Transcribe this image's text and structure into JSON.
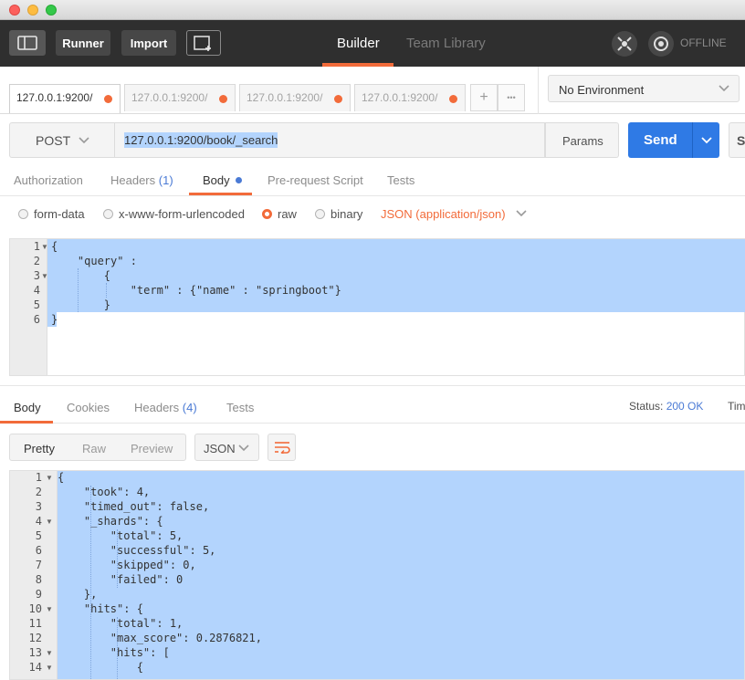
{
  "toolbar": {
    "runner_label": "Runner",
    "import_label": "Import",
    "modes": [
      "Builder",
      "Team Library"
    ],
    "offline_label": "OFFLINE"
  },
  "tabs": {
    "items": [
      {
        "label": "127.0.0.1:9200/"
      },
      {
        "label": "127.0.0.1:9200/"
      },
      {
        "label": "127.0.0.1:9200/"
      },
      {
        "label": "127.0.0.1:9200/"
      }
    ],
    "add_label": "+",
    "more_label": "•••"
  },
  "environment": {
    "selected": "No Environment"
  },
  "request": {
    "method": "POST",
    "url": "127.0.0.1:9200/book/_search",
    "params_label": "Params",
    "send_label": "Send",
    "save_label": "Sa"
  },
  "request_tabs": {
    "authorization": "Authorization",
    "headers": "Headers",
    "headers_count": "(1)",
    "body": "Body",
    "prerequest": "Pre-request Script",
    "tests": "Tests"
  },
  "body_types": {
    "form_data": "form-data",
    "urlencoded": "x-www-form-urlencoded",
    "raw": "raw",
    "binary": "binary",
    "content_type": "JSON (application/json)"
  },
  "request_body": {
    "line_numbers": [
      "1",
      "2",
      "3",
      "4",
      "5",
      "6"
    ],
    "lines": [
      "{",
      "    \"query\" :",
      "        {",
      "            \"term\" : {\"name\" : \"springboot\"}",
      "        }",
      "}"
    ]
  },
  "response_tabs": {
    "body": "Body",
    "cookies": "Cookies",
    "headers": "Headers",
    "headers_count": "(4)",
    "tests": "Tests",
    "status_label": "Status:",
    "status_value": "200 OK",
    "time_label": "Tim"
  },
  "response_view": {
    "pretty": "Pretty",
    "raw": "Raw",
    "preview": "Preview",
    "format": "JSON"
  },
  "response_body": {
    "line_numbers": [
      "1",
      "2",
      "3",
      "4",
      "5",
      "6",
      "7",
      "8",
      "9",
      "10",
      "11",
      "12",
      "13",
      "14"
    ],
    "lines": [
      "{",
      "    \"took\": 4,",
      "    \"timed_out\": false,",
      "    \"_shards\": {",
      "        \"total\": 5,",
      "        \"successful\": 5,",
      "        \"skipped\": 0,",
      "        \"failed\": 0",
      "    },",
      "    \"hits\": {",
      "        \"total\": 1,",
      "        \"max_score\": 0.2876821,",
      "        \"hits\": [",
      "            {"
    ]
  },
  "colors": {
    "accent": "#f26b3a",
    "send": "#2f7ae5",
    "selection": "#b3d4fd",
    "toolbar": "#2f2f2f"
  }
}
